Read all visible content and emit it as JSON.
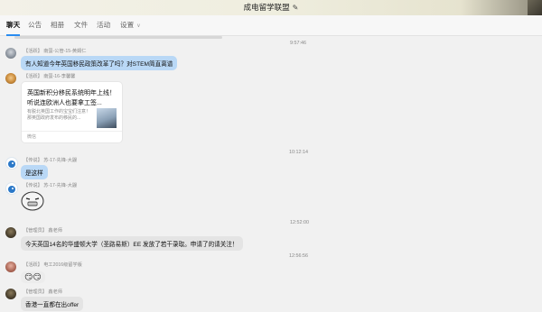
{
  "window": {
    "title": "成电留学联盟"
  },
  "tabs": [
    {
      "label": "聊天",
      "active": true
    },
    {
      "label": "公告"
    },
    {
      "label": "相册"
    },
    {
      "label": "文件"
    },
    {
      "label": "活动"
    },
    {
      "label": "设置"
    }
  ],
  "messages": {
    "ts1": "9:57:46",
    "m1": {
      "meta": "【活跃】 南蛋-公管-15-黄姆仁",
      "text": "有人知道今年英国移民政策改革了吗？对STEM简直离谱"
    },
    "m2": {
      "meta": "【活跃】 南蛋-16-李馨馨",
      "card_title": "英国新积分移民系统明年上线！听说连欧洲人也要拿工签...",
      "card_desc": "有脱北英国工作的宝宝们注意！那英国政府发布的移民的...",
      "card_source": "微信"
    },
    "ts2": "10:12:14",
    "m3": {
      "meta": "【传说】 苏-17-先锋-大鼹",
      "text": "是这样"
    },
    "m4": {
      "meta": "【传说】 苏-17-先锋-大鼹"
    },
    "ts3": "12:52:00",
    "m5": {
      "meta": "【管理员】 鑫老师",
      "text": "今天英国14名的华盛顿大学（圣路易斯）EE 发放了若干录取。申请了的请关注！"
    },
    "ts4": "12:56:56",
    "m6": {
      "meta": "【活跃】 电工2016级留学版",
      "text": "😏😏"
    },
    "m7": {
      "meta": "【管理员】 鑫老师",
      "text": "香港一直都在出offer"
    }
  },
  "colors": {
    "accent": "#2a8cf0",
    "blue_bubble": "#b9d8f6",
    "grey_bubble": "#e4e4e4"
  }
}
